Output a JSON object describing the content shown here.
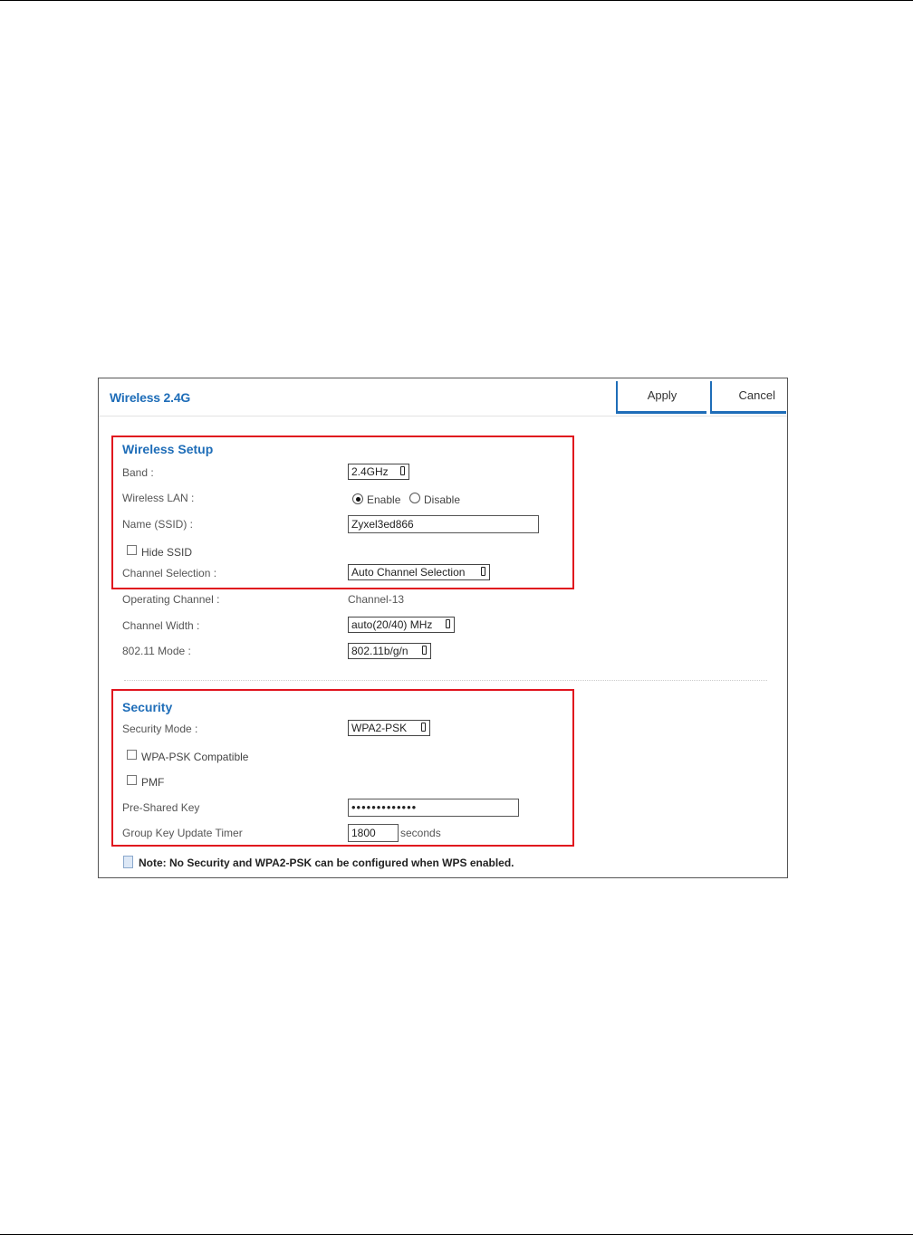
{
  "header": {
    "title": "Wireless 2.4G",
    "apply_label": "Apply",
    "cancel_label": "Cancel"
  },
  "wireless_setup": {
    "section_title": "Wireless Setup",
    "band": {
      "label": "Band :",
      "value": "2.4GHz"
    },
    "wireless_lan": {
      "label": "Wireless LAN :",
      "enable_label": "Enable",
      "disable_label": "Disable",
      "selected": "Enable"
    },
    "ssid": {
      "label": "Name (SSID) :",
      "value": "Zyxel3ed866"
    },
    "hide_ssid": {
      "label": "Hide SSID",
      "checked": false
    },
    "channel_selection": {
      "label": "Channel Selection :",
      "value": "Auto Channel Selection"
    }
  },
  "channel": {
    "operating_channel": {
      "label": "Operating Channel :",
      "value": "Channel-13"
    },
    "channel_width": {
      "label": "Channel Width :",
      "value": "auto(20/40) MHz"
    },
    "mode": {
      "label": "802.11 Mode :",
      "value": "802.11b/g/n"
    }
  },
  "security": {
    "section_title": "Security",
    "security_mode": {
      "label": "Security Mode :",
      "value": "WPA2-PSK"
    },
    "wpa_psk_compatible": {
      "label": "WPA-PSK Compatible",
      "checked": false
    },
    "pmf": {
      "label": "PMF",
      "checked": false
    },
    "pre_shared_key": {
      "label": "Pre-Shared Key",
      "value": "•••••••••••••"
    },
    "group_key_timer": {
      "label": "Group Key Update Timer",
      "value": "1800",
      "unit": "seconds"
    }
  },
  "note": "Note: No Security and WPA2-PSK can be configured when WPS enabled.",
  "colors": {
    "accent": "#1e6db8",
    "highlight": "#e0141e"
  },
  "icons": {
    "note": "note-icon",
    "dropdown": "dropdown-arrow-icon"
  }
}
